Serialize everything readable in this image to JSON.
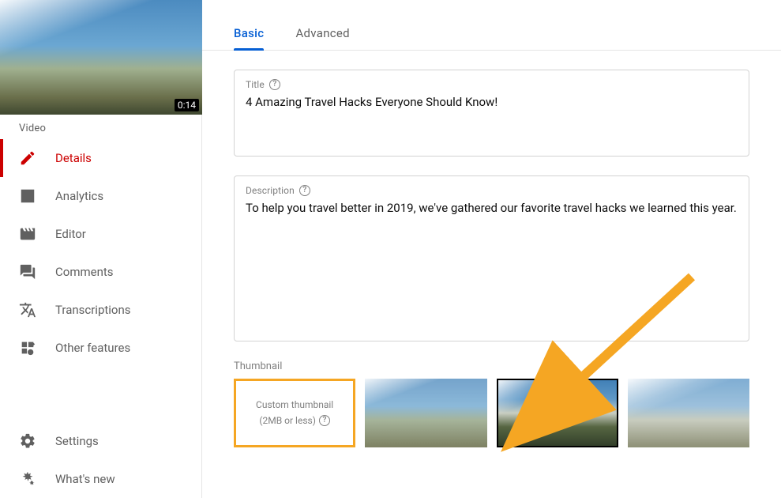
{
  "preview": {
    "duration": "0:14"
  },
  "sidebar": {
    "section_label": "Video",
    "items": [
      {
        "id": "details",
        "label": "Details",
        "icon": "pencil-icon",
        "active": true
      },
      {
        "id": "analytics",
        "label": "Analytics",
        "icon": "analytics-icon"
      },
      {
        "id": "editor",
        "label": "Editor",
        "icon": "editor-icon"
      },
      {
        "id": "comments",
        "label": "Comments",
        "icon": "comments-icon"
      },
      {
        "id": "transcriptions",
        "label": "Transcriptions",
        "icon": "translate-icon"
      },
      {
        "id": "other",
        "label": "Other features",
        "icon": "other-icon"
      }
    ],
    "footer": [
      {
        "id": "settings",
        "label": "Settings",
        "icon": "gear-icon"
      },
      {
        "id": "whatsnew",
        "label": "What's new",
        "icon": "whatsnew-icon"
      }
    ]
  },
  "tabs": {
    "basic": "Basic",
    "advanced": "Advanced",
    "active": "basic"
  },
  "title": {
    "label": "Title",
    "value": "4 Amazing Travel Hacks Everyone Should Know!"
  },
  "description": {
    "label": "Description",
    "value": "To help you travel better in 2019, we've gathered our favorite travel hacks we learned this year."
  },
  "thumbnail": {
    "section_label": "Thumbnail",
    "custom_line1": "Custom thumbnail",
    "custom_line2": "(2MB or less)",
    "selected_index": 2
  }
}
